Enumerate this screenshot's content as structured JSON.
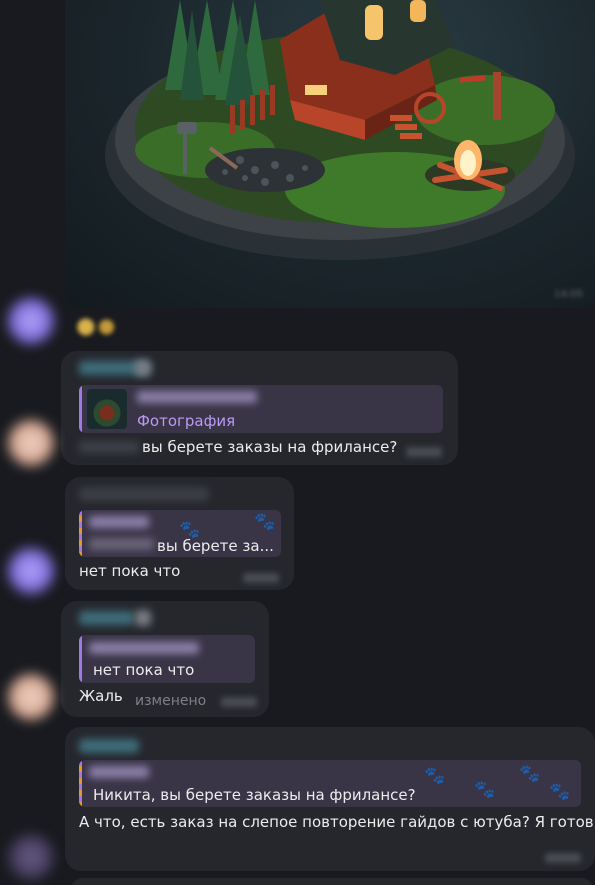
{
  "photo": {
    "image_name": "isometric-cabin-scene"
  },
  "messages": [
    {
      "reply_label": "Фотография",
      "text": "вы берете заказы на фрилансе?"
    },
    {
      "reply_text": "вы берете за...",
      "text": "нет пока что"
    },
    {
      "reply_text": "нет пока что",
      "text": "Жаль",
      "edited_label": "изменено"
    },
    {
      "reply_text": "Никита, вы берете заказы на фрилансе?",
      "text": "А что, есть заказ на слепое повторение гайдов с ютуба? Я готов)"
    }
  ],
  "colors": {
    "background": "#181a1f",
    "bubble": "#25272d",
    "accent_purple": "#9f7ae6",
    "reply_bg": "#3a3447"
  }
}
